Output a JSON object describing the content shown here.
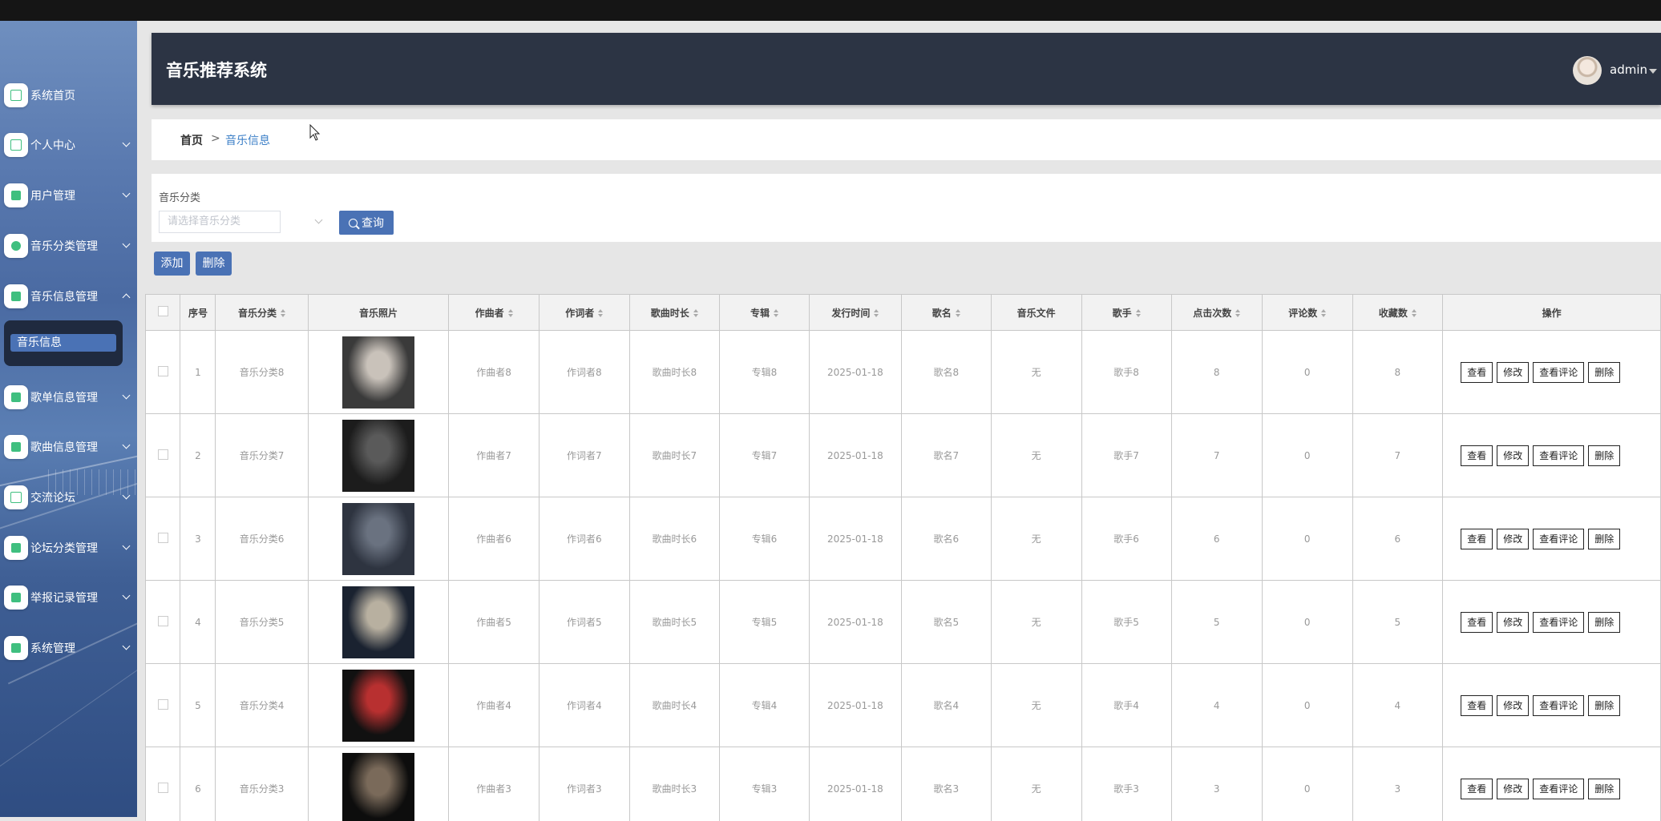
{
  "app": {
    "title": "音乐推荐系统",
    "user": "admin"
  },
  "sidebar": {
    "items": [
      {
        "label": "系统首页",
        "icon": "home-icon"
      },
      {
        "label": "个人中心",
        "icon": "profile-icon"
      },
      {
        "label": "用户管理",
        "icon": "user-icon"
      },
      {
        "label": "音乐分类管理",
        "icon": "pin-icon"
      },
      {
        "label": "音乐信息管理",
        "icon": "film-icon"
      },
      {
        "label": "歌单信息管理",
        "icon": "grid-icon"
      },
      {
        "label": "歌曲信息管理",
        "icon": "grid-icon"
      },
      {
        "label": "交流论坛",
        "icon": "sliders-icon"
      },
      {
        "label": "论坛分类管理",
        "icon": "book-icon"
      },
      {
        "label": "举报记录管理",
        "icon": "grid-icon"
      },
      {
        "label": "系统管理",
        "icon": "flag-icon"
      }
    ],
    "active_sub": "音乐信息"
  },
  "breadcrumb": {
    "home": "首页",
    "sep": ">",
    "current": "音乐信息"
  },
  "search": {
    "label": "音乐分类",
    "placeholder": "请选择音乐分类",
    "query_button": "查询"
  },
  "actions": {
    "add": "添加",
    "delete": "删除"
  },
  "table": {
    "headers": [
      "序号",
      "音乐分类",
      "音乐照片",
      "作曲者",
      "作词者",
      "歌曲时长",
      "专辑",
      "发行时间",
      "歌名",
      "音乐文件",
      "歌手",
      "点击次数",
      "评论数",
      "收藏数",
      "操作"
    ],
    "rows": [
      {
        "no": "1",
        "category": "音乐分类8",
        "composer": "作曲者8",
        "lyricist": "作词者8",
        "duration": "歌曲时长8",
        "album": "专辑8",
        "date": "2025-01-18",
        "song": "歌名8",
        "file": "无",
        "singer": "歌手8",
        "clicks": "8",
        "comments": "0",
        "favorites": "8",
        "photo_colors": [
          "#3a3a3a",
          "#c9c2ba"
        ]
      },
      {
        "no": "2",
        "category": "音乐分类7",
        "composer": "作曲者7",
        "lyricist": "作词者7",
        "duration": "歌曲时长7",
        "album": "专辑7",
        "date": "2025-01-18",
        "song": "歌名7",
        "file": "无",
        "singer": "歌手7",
        "clicks": "7",
        "comments": "0",
        "favorites": "7",
        "photo_colors": [
          "#1c1c1c",
          "#5a5a5a"
        ]
      },
      {
        "no": "3",
        "category": "音乐分类6",
        "composer": "作曲者6",
        "lyricist": "作词者6",
        "duration": "歌曲时长6",
        "album": "专辑6",
        "date": "2025-01-18",
        "song": "歌名6",
        "file": "无",
        "singer": "歌手6",
        "clicks": "6",
        "comments": "0",
        "favorites": "6",
        "photo_colors": [
          "#2e3440",
          "#6a7280"
        ]
      },
      {
        "no": "4",
        "category": "音乐分类5",
        "composer": "作曲者5",
        "lyricist": "作词者5",
        "duration": "歌曲时长5",
        "album": "专辑5",
        "date": "2025-01-18",
        "song": "歌名5",
        "file": "无",
        "singer": "歌手5",
        "clicks": "5",
        "comments": "0",
        "favorites": "5",
        "photo_colors": [
          "#1a2230",
          "#b8b0a0"
        ]
      },
      {
        "no": "5",
        "category": "音乐分类4",
        "composer": "作曲者4",
        "lyricist": "作词者4",
        "duration": "歌曲时长4",
        "album": "专辑4",
        "date": "2025-01-18",
        "song": "歌名4",
        "file": "无",
        "singer": "歌手4",
        "clicks": "4",
        "comments": "0",
        "favorites": "4",
        "photo_colors": [
          "#111111",
          "#b83030"
        ]
      },
      {
        "no": "6",
        "category": "音乐分类3",
        "composer": "作曲者3",
        "lyricist": "作词者3",
        "duration": "歌曲时长3",
        "album": "专辑3",
        "date": "2025-01-18",
        "song": "歌名3",
        "file": "无",
        "singer": "歌手3",
        "clicks": "3",
        "comments": "0",
        "favorites": "3",
        "photo_colors": [
          "#0d0d0d",
          "#7a6a5a"
        ]
      }
    ],
    "row_actions": [
      "查看",
      "修改",
      "查看评论",
      "删除"
    ]
  },
  "colors": {
    "header_bg": "#2c3444",
    "accent": "#4a72b5",
    "menu_icon": "#3fbf7f",
    "link": "#3c7fc7"
  }
}
